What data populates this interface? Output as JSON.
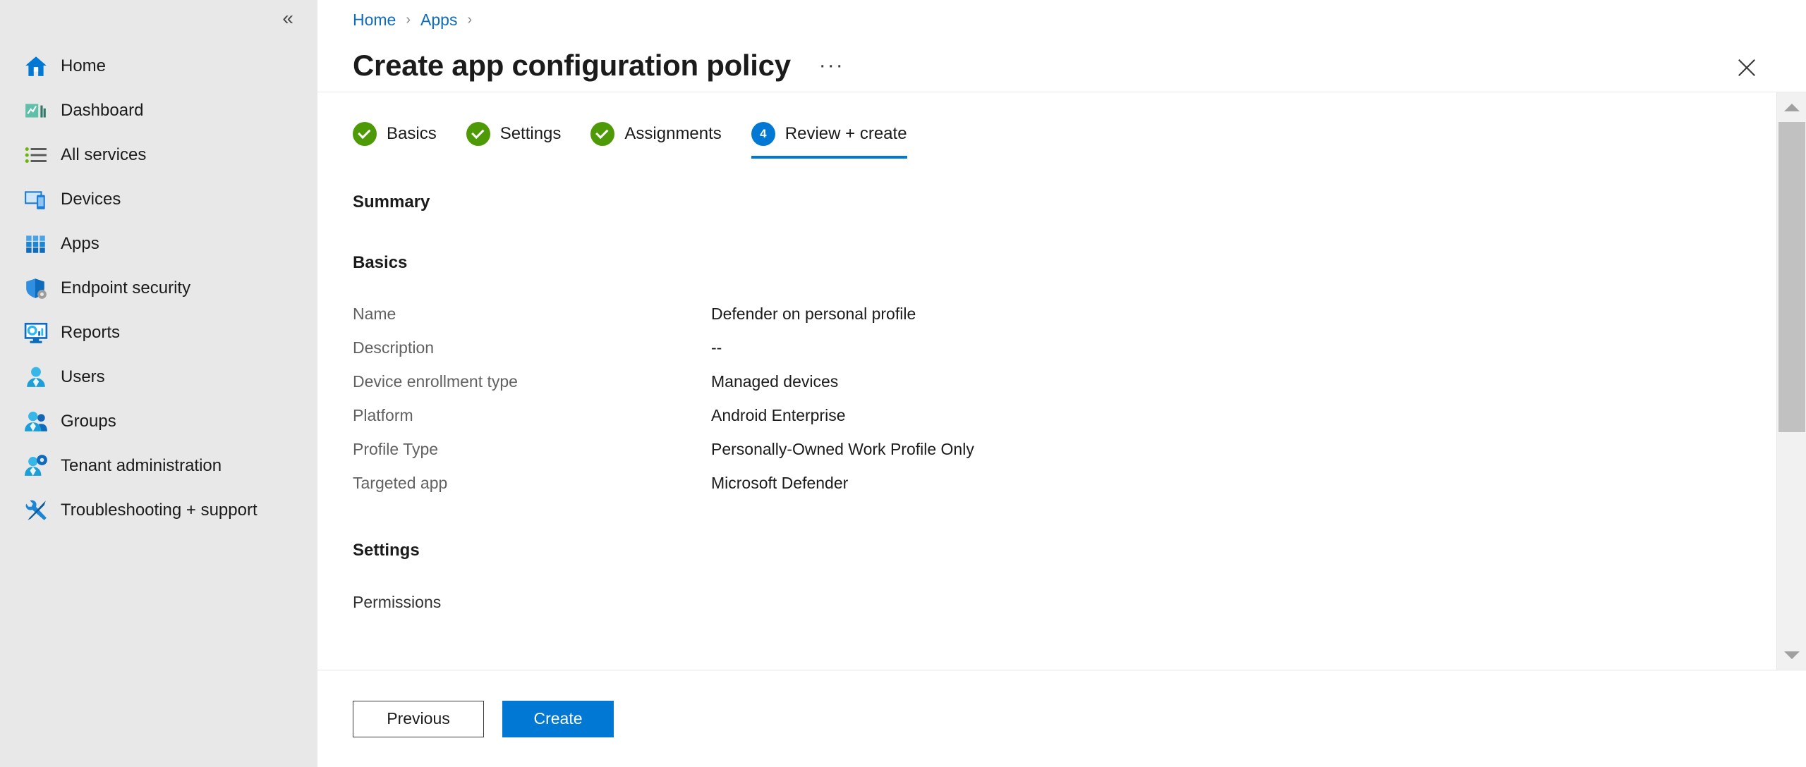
{
  "sidebar": {
    "collapse_label": "«",
    "items": [
      {
        "label": "Home",
        "icon": "home-icon"
      },
      {
        "label": "Dashboard",
        "icon": "dashboard-icon"
      },
      {
        "label": "All services",
        "icon": "all-services-icon"
      },
      {
        "label": "Devices",
        "icon": "devices-icon"
      },
      {
        "label": "Apps",
        "icon": "apps-grid-icon"
      },
      {
        "label": "Endpoint security",
        "icon": "shield-gear-icon"
      },
      {
        "label": "Reports",
        "icon": "reports-monitor-icon"
      },
      {
        "label": "Users",
        "icon": "user-icon"
      },
      {
        "label": "Groups",
        "icon": "groups-icon"
      },
      {
        "label": "Tenant administration",
        "icon": "user-gear-icon"
      },
      {
        "label": "Troubleshooting + support",
        "icon": "wrench-screwdriver-icon"
      }
    ]
  },
  "breadcrumb": {
    "items": [
      "Home",
      "Apps"
    ],
    "separator": "›"
  },
  "header": {
    "title": "Create app configuration policy",
    "ellipsis": "···",
    "close_label": "×"
  },
  "wizard": {
    "tabs": [
      {
        "label": "Basics",
        "state": "done",
        "number": "1"
      },
      {
        "label": "Settings",
        "state": "done",
        "number": "2"
      },
      {
        "label": "Assignments",
        "state": "done",
        "number": "3"
      },
      {
        "label": "Review + create",
        "state": "current",
        "number": "4"
      }
    ]
  },
  "summary": {
    "heading": "Summary",
    "basics": {
      "heading": "Basics",
      "rows": [
        {
          "key": "Name",
          "value": "Defender on personal profile"
        },
        {
          "key": "Description",
          "value": "--"
        },
        {
          "key": "Device enrollment type",
          "value": "Managed devices"
        },
        {
          "key": "Platform",
          "value": "Android Enterprise"
        },
        {
          "key": "Profile Type",
          "value": "Personally-Owned Work Profile Only"
        },
        {
          "key": "Targeted app",
          "value": "Microsoft Defender"
        }
      ]
    },
    "settings": {
      "heading": "Settings",
      "permissions_label": "Permissions"
    }
  },
  "footer": {
    "previous_label": "Previous",
    "create_label": "Create"
  },
  "colors": {
    "accent": "#0078d4",
    "link": "#0f6cbd",
    "success": "#4e9a06",
    "sidebar_bg": "#e8e8e8",
    "scrollbar_thumb": "#c1c1c1"
  }
}
